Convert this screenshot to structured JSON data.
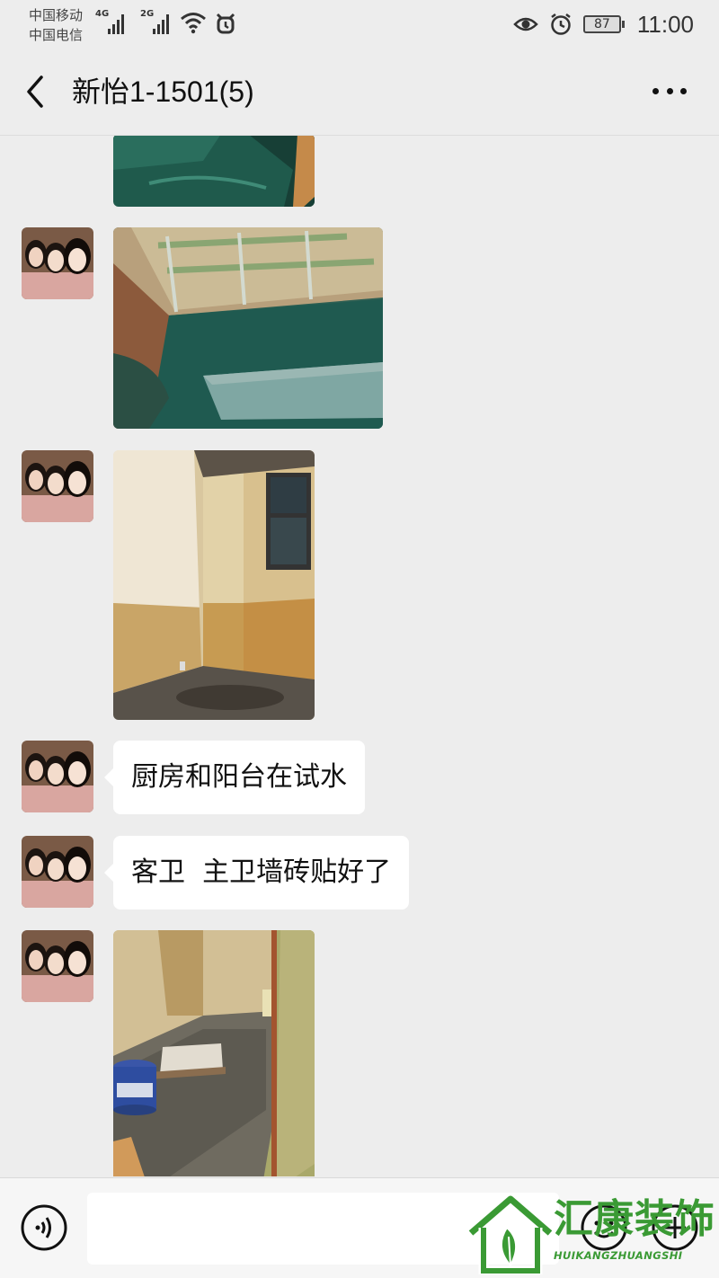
{
  "status_bar": {
    "carrier_1": "中国移动",
    "carrier_2": "中国电信",
    "network_1": "4G",
    "network_2": "2G",
    "battery": "87",
    "time": "11:00"
  },
  "nav": {
    "title": "新怡1-1501(5)"
  },
  "messages": [
    {
      "type": "image",
      "content": "pool-water-partial"
    },
    {
      "type": "image",
      "content": "balcony-water-test"
    },
    {
      "type": "image",
      "content": "tiled-bathroom"
    },
    {
      "type": "text",
      "text": "厨房和阳台在试水"
    },
    {
      "type": "text",
      "text": "客卫  主卫墙砖贴好了"
    },
    {
      "type": "image",
      "content": "bathroom-floor-bucket"
    }
  ],
  "input_bar": {
    "value": ""
  },
  "watermark": {
    "name": "汇康装饰",
    "pinyin": "HUIKANGZHUANGSHI"
  },
  "colors": {
    "background": "#ededed",
    "bubble": "#ffffff",
    "watermark": "#3a9a34"
  }
}
